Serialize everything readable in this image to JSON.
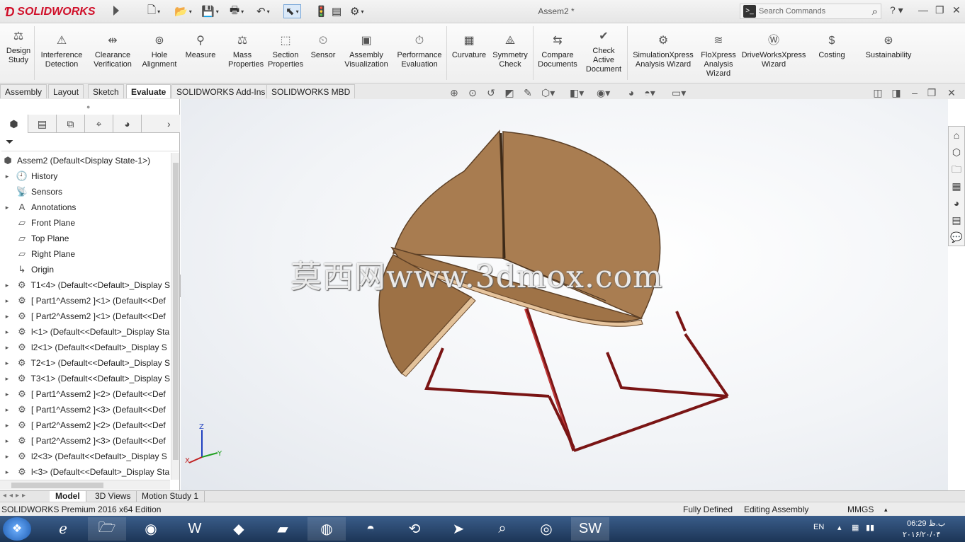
{
  "app": {
    "logo": "SOLIDWORKS",
    "doc_title": "Assem2 *"
  },
  "search": {
    "placeholder": "Search Commands"
  },
  "ribbon": {
    "buttons": [
      {
        "label": "Design\nStudy",
        "icon": "design-study-icon"
      },
      {
        "label": "Interference\nDetection",
        "icon": "interference-icon"
      },
      {
        "label": "Clearance\nVerification",
        "icon": "clearance-icon"
      },
      {
        "label": "Hole\nAlignment",
        "icon": "hole-icon"
      },
      {
        "label": "Measure",
        "icon": "measure-icon"
      },
      {
        "label": "Mass\nProperties",
        "icon": "mass-icon"
      },
      {
        "label": "Section\nProperties",
        "icon": "section-icon"
      },
      {
        "label": "Sensor",
        "icon": "sensor-icon"
      },
      {
        "label": "Assembly\nVisualization",
        "icon": "assembly-vis-icon"
      },
      {
        "label": "Performance\nEvaluation",
        "icon": "performance-icon"
      },
      {
        "label": "Curvature",
        "icon": "curvature-icon"
      },
      {
        "label": "Symmetry\nCheck",
        "icon": "symmetry-icon"
      },
      {
        "label": "Compare\nDocuments",
        "icon": "compare-icon"
      },
      {
        "label": "Check\nActive\nDocument",
        "icon": "check-doc-icon"
      },
      {
        "label": "SimulationXpress\nAnalysis Wizard",
        "icon": "simxpress-icon"
      },
      {
        "label": "FloXpress\nAnalysis\nWizard",
        "icon": "floxpress-icon"
      },
      {
        "label": "DriveWorksXpress\nWizard",
        "icon": "driveworks-icon"
      },
      {
        "label": "Costing",
        "icon": "costing-icon"
      },
      {
        "label": "Sustainability",
        "icon": "sustainability-icon"
      }
    ]
  },
  "tabs": [
    "Assembly",
    "Layout",
    "Sketch",
    "Evaluate",
    "SOLIDWORKS Add-Ins",
    "SOLIDWORKS MBD"
  ],
  "active_tab": "Evaluate",
  "tree": {
    "root": "Assem2  (Default<Display State-1>)",
    "items": [
      {
        "label": "History",
        "exp": true
      },
      {
        "label": "Sensors",
        "exp": false
      },
      {
        "label": "Annotations",
        "exp": true
      },
      {
        "label": "Front Plane",
        "exp": false
      },
      {
        "label": "Top Plane",
        "exp": false
      },
      {
        "label": "Right Plane",
        "exp": false
      },
      {
        "label": "Origin",
        "exp": false
      },
      {
        "label": "T1<4> (Default<<Default>_Display S",
        "exp": true
      },
      {
        "label": "[ Part1^Assem2 ]<1> (Default<<Def",
        "exp": true
      },
      {
        "label": "[ Part2^Assem2 ]<1> (Default<<Def",
        "exp": true
      },
      {
        "label": "l<1> (Default<<Default>_Display Sta",
        "exp": true
      },
      {
        "label": "l2<1> (Default<<Default>_Display S",
        "exp": true
      },
      {
        "label": "T2<1> (Default<<Default>_Display S",
        "exp": true
      },
      {
        "label": "T3<1> (Default<<Default>_Display S",
        "exp": true
      },
      {
        "label": "[ Part1^Assem2 ]<2> (Default<<Def",
        "exp": true
      },
      {
        "label": "[ Part1^Assem2 ]<3> (Default<<Def",
        "exp": true
      },
      {
        "label": "[ Part2^Assem2 ]<2> (Default<<Def",
        "exp": true
      },
      {
        "label": "[ Part2^Assem2 ]<3> (Default<<Def",
        "exp": true
      },
      {
        "label": "l2<3> (Default<<Default>_Display S",
        "exp": true
      },
      {
        "label": "l<3> (Default<<Default>_Display Sta",
        "exp": true
      }
    ]
  },
  "watermark": "莫西网www.3dmox.com",
  "triad": {
    "x": "X",
    "y": "Y",
    "z": "Z"
  },
  "bottom_tabs": [
    "Model",
    "3D Views",
    "Motion Study 1"
  ],
  "status": {
    "edition": "SOLIDWORKS Premium 2016 x64 Edition",
    "defined": "Fully Defined",
    "mode": "Editing Assembly",
    "units": "MMGS"
  },
  "tray": {
    "lang": "EN",
    "time": "06:29 ب.ظ",
    "date": "۲۰۱۶/۲۰/۰۴"
  },
  "colors": {
    "accent": "#d0102a",
    "wood": "#a97c52",
    "frame": "#8b1a1a"
  }
}
